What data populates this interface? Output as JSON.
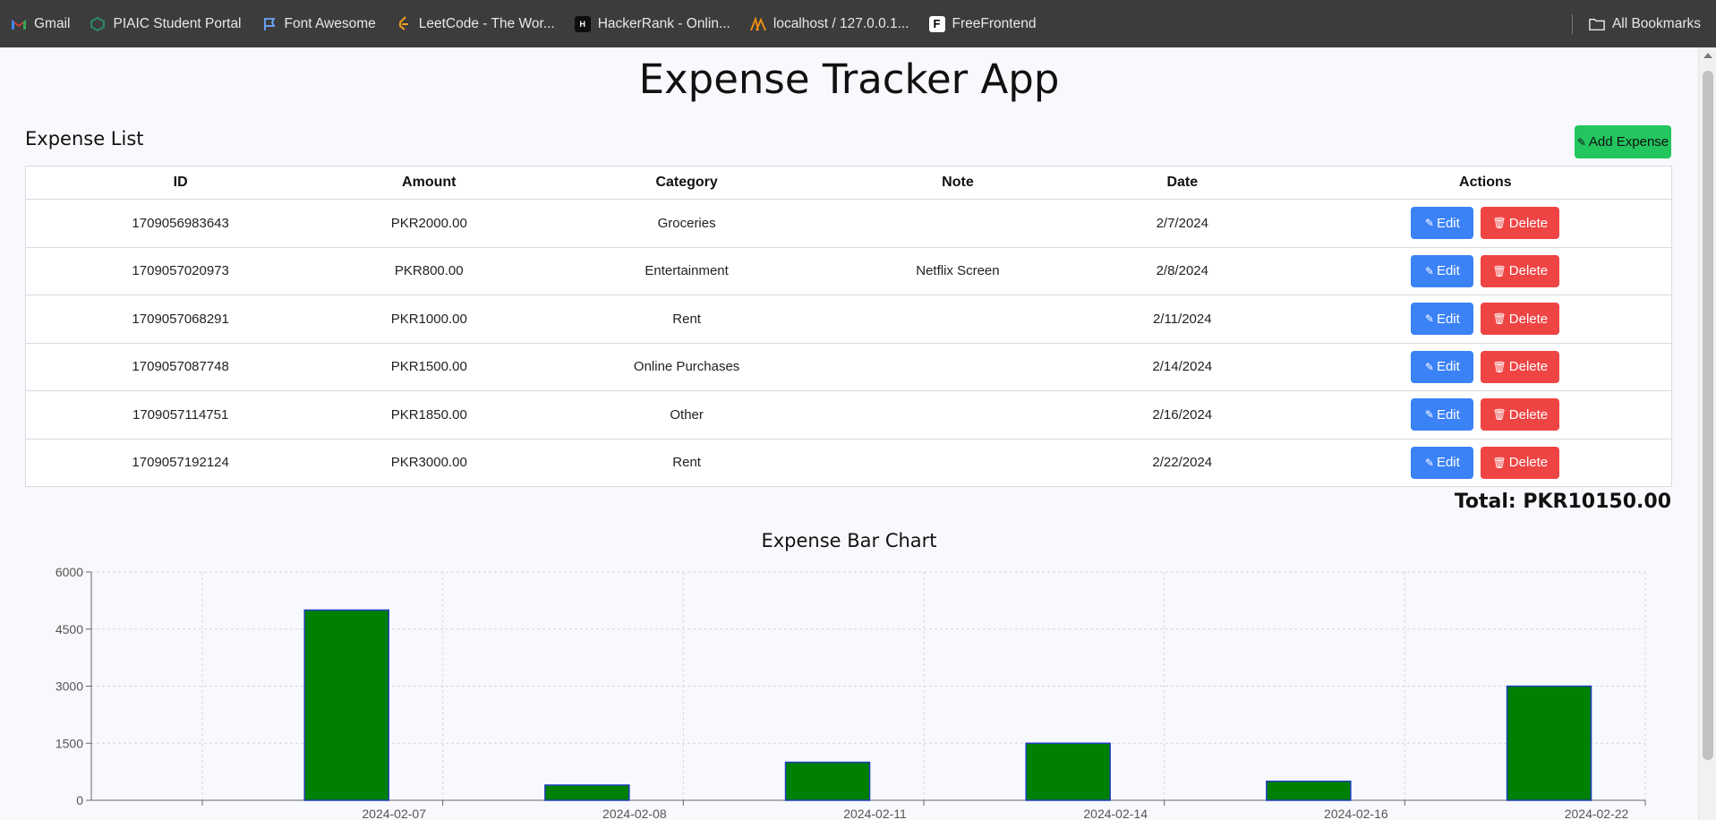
{
  "bookmarks": [
    {
      "label": "Gmail",
      "icon": "gmail-icon"
    },
    {
      "label": "PIAIC Student Portal",
      "icon": "piaic-icon"
    },
    {
      "label": "Font Awesome",
      "icon": "flag-icon"
    },
    {
      "label": "LeetCode - The Wor...",
      "icon": "leetcode-icon"
    },
    {
      "label": "HackerRank - Onlin...",
      "icon": "hackerrank-icon"
    },
    {
      "label": "localhost / 127.0.0.1...",
      "icon": "phpmyadmin-icon"
    },
    {
      "label": "FreeFrontend",
      "icon": "freefrontend-icon"
    }
  ],
  "all_bookmarks": "All Bookmarks",
  "app_title": "Expense Tracker App",
  "list_title": "Expense List",
  "add_button": "Add Expense",
  "table": {
    "headers": [
      "ID",
      "Amount",
      "Category",
      "Note",
      "Date",
      "Actions"
    ],
    "edit_label": "Edit",
    "delete_label": "Delete",
    "rows": [
      {
        "id": "1709056983643",
        "amount": "PKR2000.00",
        "category": "Groceries",
        "note": "",
        "date": "2/7/2024"
      },
      {
        "id": "1709057020973",
        "amount": "PKR800.00",
        "category": "Entertainment",
        "note": "Netflix Screen",
        "date": "2/8/2024"
      },
      {
        "id": "1709057068291",
        "amount": "PKR1000.00",
        "category": "Rent",
        "note": "",
        "date": "2/11/2024"
      },
      {
        "id": "1709057087748",
        "amount": "PKR1500.00",
        "category": "Online Purchases",
        "note": "",
        "date": "2/14/2024"
      },
      {
        "id": "1709057114751",
        "amount": "PKR1850.00",
        "category": "Other",
        "note": "",
        "date": "2/16/2024"
      },
      {
        "id": "1709057192124",
        "amount": "PKR3000.00",
        "category": "Rent",
        "note": "",
        "date": "2/22/2024"
      }
    ]
  },
  "total": "Total: PKR10150.00",
  "chart_title": "Expense Bar Chart",
  "colors": {
    "bar_fill": "#008000",
    "bar_stroke": "#1f3fbf",
    "add_button": "#22c55e",
    "edit_button": "#3b82f6",
    "delete_button": "#ef4444"
  },
  "chart_data": {
    "type": "bar",
    "title": "Expense Bar Chart",
    "categories": [
      "2024-02-07",
      "2024-02-08",
      "2024-02-11",
      "2024-02-14",
      "2024-02-16",
      "2024-02-22"
    ],
    "values": [
      5000,
      400,
      1000,
      1500,
      500,
      3000
    ],
    "yticks": [
      0,
      1500,
      3000,
      4500,
      6000
    ],
    "ylim": [
      0,
      6000
    ],
    "grid": true
  }
}
